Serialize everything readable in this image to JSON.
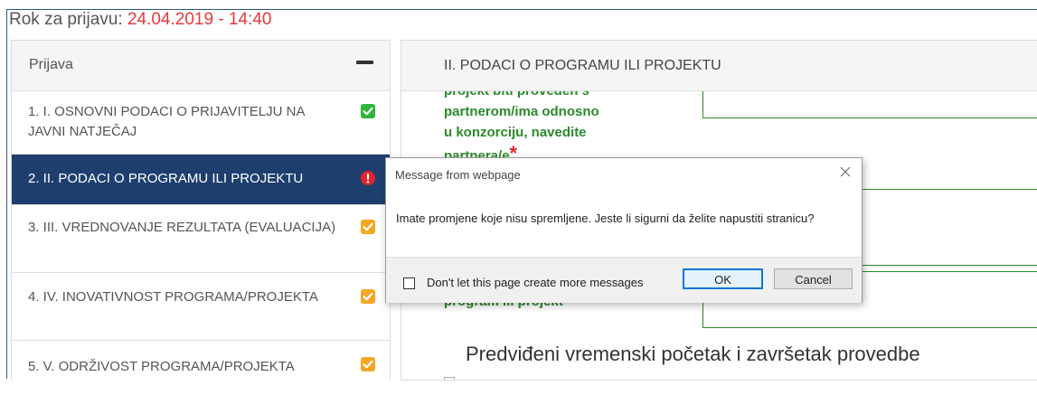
{
  "deadline": {
    "label": "Rok za prijavu: ",
    "value": "24.04.2019 - 14:40"
  },
  "sidebar": {
    "title": "Prijava",
    "items": [
      {
        "label": "1. I. OSNOVNI PODACI O PRIJAVITELJU NA JAVNI NATJEČAJ",
        "status": "complete"
      },
      {
        "label": "2. II. PODACI O PROGRAMU ILI PROJEKTU",
        "status": "error"
      },
      {
        "label": "3. III. VREDNOVANJE REZULTATA (EVALUACIJA)",
        "status": "incomplete"
      },
      {
        "label": "4. IV. INOVATIVNOST PROGRAMA/PROJEKTA",
        "status": "incomplete"
      },
      {
        "label": "5. V. ODRŽIVOST PROGRAMA/PROJEKTA",
        "status": "incomplete"
      }
    ]
  },
  "main": {
    "title": "II. PODACI O PROGRAMU ILI PROJEKTU",
    "question_lines": [
      "projekt biti proveden s",
      "partnerom/ima odnosno",
      "u konzorciju, navedite",
      "partnera/e"
    ],
    "question2_fragment": "program ili projekt",
    "section_title": "Predviđeni vremenski početak i završetak provedbe"
  },
  "dialog": {
    "title": "Message from webpage",
    "message": "Imate promjene koje nisu spremljene. Jeste li sigurni da želite napustiti stranicu?",
    "checkbox_label": "Don't let this page create more messages",
    "ok_label": "OK",
    "cancel_label": "Cancel"
  },
  "colors": {
    "active_item_bg": "#1e3f6e",
    "status_complete": "#2fb53c",
    "status_incomplete": "#f5a623",
    "status_error": "#e0252b",
    "question_text": "#2b8a2b",
    "deadline_date": "#e8383b"
  }
}
